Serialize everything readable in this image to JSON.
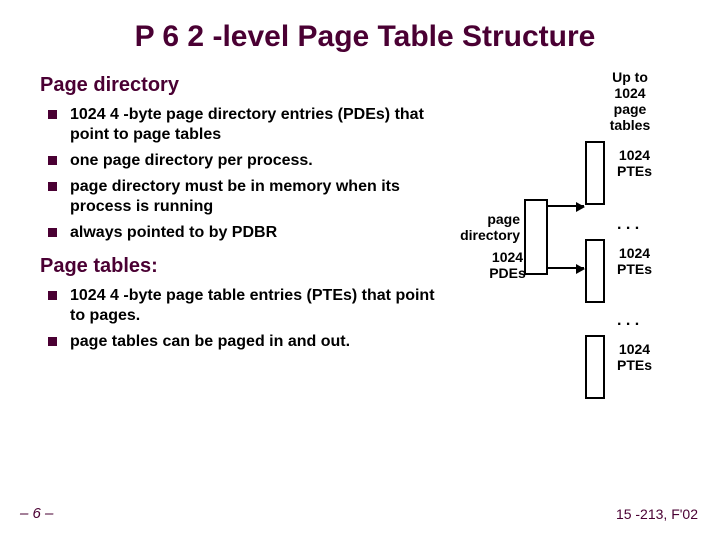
{
  "title": "P 6 2 -level Page Table Structure",
  "sections": [
    {
      "heading": "Page directory",
      "bullets": [
        "1024 4 -byte page directory entries (PDEs) that point to page tables",
        "one page directory per process.",
        "page directory must be in memory when its process is running",
        "always pointed to by PDBR"
      ]
    },
    {
      "heading": "Page tables:",
      "bullets": [
        "1024 4 -byte page table entries (PTEs) that point to pages.",
        "page tables can be paged in and out."
      ]
    }
  ],
  "diagram": {
    "top_label": "Up to 1024 page tables",
    "ptes_label": "1024 PTEs",
    "pd_label": "page directory",
    "pdes_label": "1024 PDEs"
  },
  "footer": {
    "left": "– 6 –",
    "right": "15 -213, F'02"
  }
}
